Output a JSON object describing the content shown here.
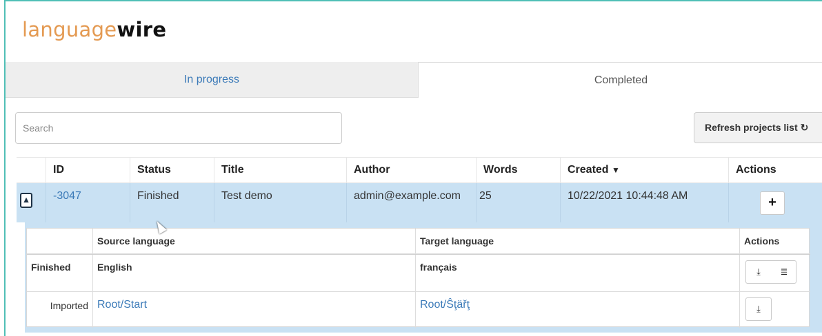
{
  "logo": {
    "part1": "language",
    "part2": "wire"
  },
  "tabs": [
    {
      "label": "In progress",
      "active": false
    },
    {
      "label": "Completed",
      "active": true
    }
  ],
  "search": {
    "placeholder": "Search",
    "value": ""
  },
  "refresh": {
    "label": "Refresh projects list",
    "icon": "refresh-icon"
  },
  "table": {
    "headers": [
      "ID",
      "Status",
      "Title",
      "Author",
      "Words",
      "Created",
      "Actions"
    ],
    "sort_indicator": "▼",
    "rows": [
      {
        "expanded": true,
        "id": "-3047",
        "status": "Finished",
        "title": "Test demo",
        "author": "admin@example.com",
        "words": "25",
        "created": "10/22/2021 10:44:48 AM",
        "action_icon": "plus-icon"
      }
    ]
  },
  "subtable": {
    "headers": [
      "Source language",
      "Target language",
      "Actions"
    ],
    "rows": [
      {
        "status": "Finished",
        "source": "English",
        "target": "français",
        "actions": [
          "download-icon",
          "queue-icon"
        ]
      },
      {
        "status": "Imported",
        "source": "Root/Start",
        "target": "Root/Ŝţäřţ",
        "actions": [
          "download-icon"
        ]
      }
    ]
  },
  "colors": {
    "accent": "#4fbfb6",
    "link": "#3b7ab8",
    "row_highlight": "#c9e1f3",
    "logo_orange": "#e49a52"
  }
}
